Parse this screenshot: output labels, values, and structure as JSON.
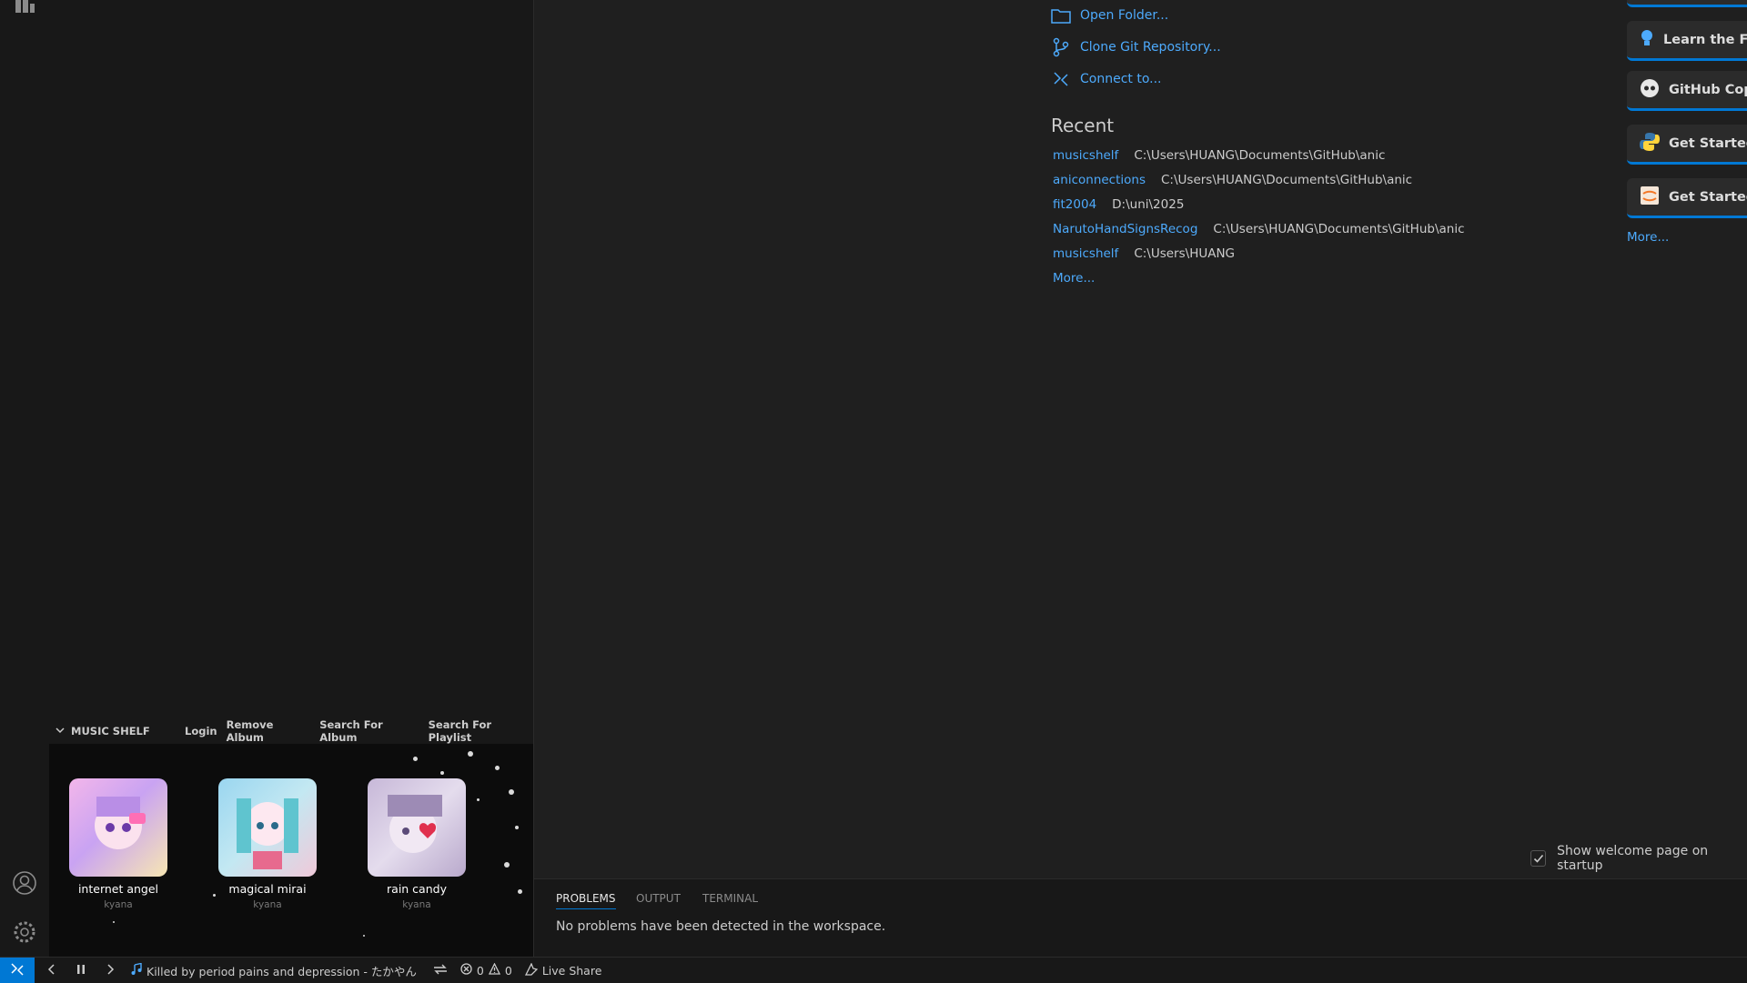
{
  "sidebar": {
    "music_shelf": {
      "title": "MUSIC SHELF",
      "actions": [
        "Login",
        "Remove Album",
        "Search For Album",
        "Search For Playlist"
      ],
      "albums": [
        {
          "name": "internet angel",
          "artist": "kyana"
        },
        {
          "name": "magical mirai",
          "artist": "kyana"
        },
        {
          "name": "rain candy",
          "artist": "kyana"
        }
      ]
    }
  },
  "start": {
    "links": [
      "Open Folder...",
      "Clone Git Repository...",
      "Connect to..."
    ]
  },
  "recent": {
    "title": "Recent",
    "items": [
      {
        "name": "musicshelf",
        "path": "C:\\Users\\HUANG\\Documents\\GitHub\\anic"
      },
      {
        "name": "aniconnections",
        "path": "C:\\Users\\HUANG\\Documents\\GitHub\\anic"
      },
      {
        "name": "fit2004",
        "path": "D:\\uni\\2025"
      },
      {
        "name": "NarutoHandSignsRecog",
        "path": "C:\\Users\\HUANG\\Documents\\GitHub\\anic"
      },
      {
        "name": "musicshelf",
        "path": "C:\\Users\\HUANG"
      }
    ],
    "more": "More..."
  },
  "walkthroughs": {
    "items": [
      "Learn the Fur",
      "GitHub Copil",
      "Get Started v",
      "Get Started v"
    ],
    "more": "More..."
  },
  "welcome": {
    "show_on_startup_label": "Show welcome page on startup",
    "show_on_startup_checked": true
  },
  "panel": {
    "tabs": [
      "PROBLEMS",
      "OUTPUT",
      "TERMINAL"
    ],
    "active_tab": "PROBLEMS",
    "message": "No problems have been detected in the workspace."
  },
  "statusbar": {
    "now_playing": "Killed by period pains and depression - たかやん",
    "errors": "0",
    "warnings": "0",
    "live_share": "Live Share"
  },
  "colors": {
    "accent": "#0078d4",
    "link": "#4daafc",
    "background": "#1f1f1f",
    "sidebar": "#181818"
  }
}
